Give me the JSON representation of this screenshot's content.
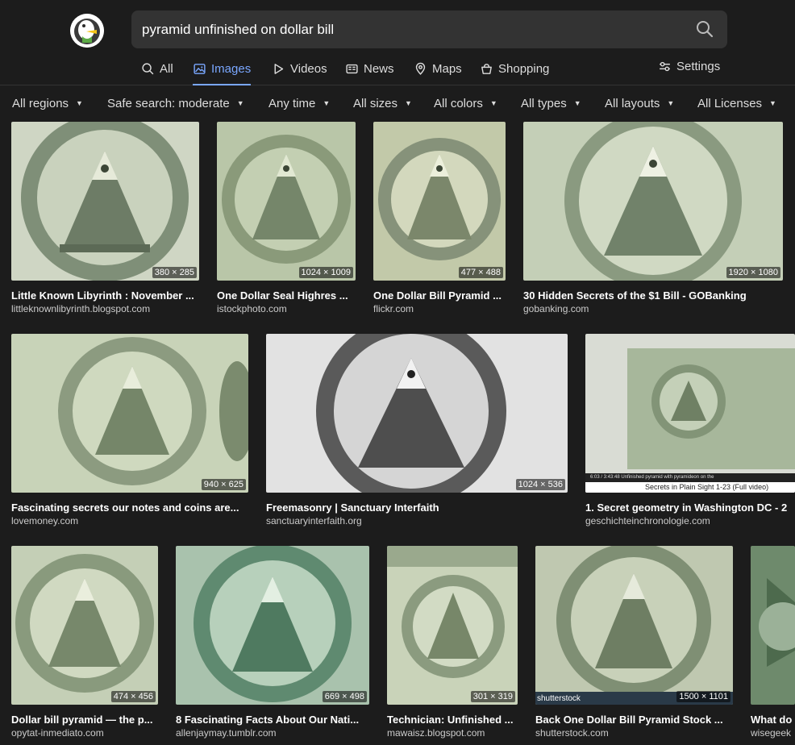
{
  "search": {
    "query": "pyramid unfinished on dollar bill"
  },
  "tabs": [
    {
      "label": "All"
    },
    {
      "label": "Images"
    },
    {
      "label": "Videos"
    },
    {
      "label": "News"
    },
    {
      "label": "Maps"
    },
    {
      "label": "Shopping"
    }
  ],
  "settings_label": "Settings",
  "filters": [
    {
      "label": "All regions"
    },
    {
      "label": "Safe search: moderate"
    },
    {
      "label": "Any time"
    },
    {
      "label": "All sizes"
    },
    {
      "label": "All colors"
    },
    {
      "label": "All types"
    },
    {
      "label": "All layouts"
    },
    {
      "label": "All Licenses"
    }
  ],
  "results": [
    {
      "title": "Little Known Libyrinth : November ...",
      "source": "littleknownlibyrinth.blogspot.com",
      "dims": "380 × 285"
    },
    {
      "title": "One Dollar Seal Highres ...",
      "source": "istockphoto.com",
      "dims": "1024 × 1009"
    },
    {
      "title": "One Dollar Bill Pyramid ...",
      "source": "flickr.com",
      "dims": "477 × 488"
    },
    {
      "title": "30 Hidden Secrets of the $1 Bill - GOBanking",
      "source": "gobanking.com",
      "dims": "1920 × 1080"
    },
    {
      "title": "Fascinating secrets our notes and coins are...",
      "source": "lovemoney.com",
      "dims": "940 × 625"
    },
    {
      "title": "Freemasonry | Sanctuary Interfaith",
      "source": "sanctuaryinterfaith.org",
      "dims": "1024 × 536"
    },
    {
      "title": "1. Secret geometry in Washington DC - 2",
      "source": "geschichteinchronologie.com",
      "dims": ""
    },
    {
      "title": "Dollar bill pyramid — the p...",
      "source": "opytat-inmediato.com",
      "dims": "474 × 456"
    },
    {
      "title": "8 Fascinating Facts About Our Nati...",
      "source": "allenjaymay.tumblr.com",
      "dims": "669 × 498"
    },
    {
      "title": "Technician: Unfinished ...",
      "source": "mawaisz.blogspot.com",
      "dims": "301 × 319"
    },
    {
      "title": "Back One Dollar Bill Pyramid Stock ...",
      "source": "shutterstock.com",
      "dims": "1500 × 1101"
    },
    {
      "title": "What do",
      "source": "wisegeek"
    }
  ],
  "video": {
    "controls": "6:03 / 3:43:48       Unfinished pyramid with pyramideon on the",
    "title": "Secrets in Plain Sight 1-23 (Full video)"
  },
  "shutterstock_watermark": "shutterstock",
  "colors": {
    "accent": "#7aa7ff",
    "background": "#1c1c1c",
    "search_bg": "#333333"
  }
}
